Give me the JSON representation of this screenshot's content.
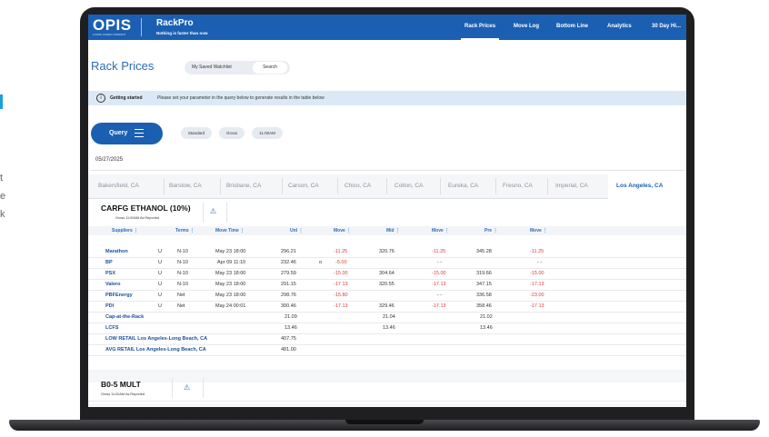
{
  "background_letters": [
    "t",
    "e",
    "k"
  ],
  "header": {
    "logo": "OPIS",
    "logo_subtitle": "A DOW JONES COMPANY",
    "app_name": "RackPro",
    "app_tagline": "Nothing is faster than now",
    "nav": [
      "Rack Prices",
      "Move Log",
      "Bottom Line",
      "Analytics",
      "30 Day Hi..."
    ],
    "active_nav": "Rack Prices"
  },
  "page": {
    "title": "Rack Prices",
    "toggle": {
      "left": "My Saved Watchlist",
      "right": "Search"
    },
    "banner": {
      "bold": "Getting started",
      "text": "Please set your parameter in the query below to generate results in the table below"
    },
    "query_button": "Query",
    "chips": [
      "Standard",
      "Gross",
      "11:00AM"
    ],
    "date": "05/27/2025"
  },
  "city_tabs": [
    "Bakersfield, CA",
    "Barstow, CA",
    "Brisbane, CA",
    "Carson, CA",
    "Chico, CA",
    "Colton, CA",
    "Eureka, CA",
    "Fresno, CA",
    "Imperial, CA",
    "Los Angeles, CA"
  ],
  "active_city": "Los Angeles, CA",
  "product1": {
    "title": "CARFG ETHANOL (10%)",
    "subtitle": "Gross 11:00AM As Reported"
  },
  "table": {
    "headers": {
      "suppliers": "Suppliers ⋮",
      "terms": "Terms ⋮",
      "move_time": "Move Time ⋮",
      "unl": "Unl ⋮",
      "move1": "Move ⋮",
      "mid": "Mid ⋮",
      "move2": "Move ⋮",
      "pre": "Pre ⋮",
      "move3": "Move ⋮"
    },
    "rows": [
      {
        "supplier": "Marathon",
        "u": "U",
        "terms": "N-10",
        "time": "May 23 18:00",
        "unl": "296.21",
        "flag": "",
        "move1": "-11.25",
        "mid": "320.76",
        "move2": "-11.25",
        "pre": "345.28",
        "move3": "-11.25"
      },
      {
        "supplier": "BP",
        "u": "U",
        "terms": "N-10",
        "time": "Apr 09 11:10",
        "unl": "232.46",
        "flag": "o",
        "move1": "-5.00",
        "mid": "",
        "move2": "- -",
        "pre": "",
        "move3": "- -"
      },
      {
        "supplier": "PSX",
        "u": "U",
        "terms": "N-10",
        "time": "May 23 18:00",
        "unl": "279.59",
        "flag": "",
        "move1": "-15.00",
        "mid": "304.64",
        "move2": "-15.00",
        "pre": "319.66",
        "move3": "-15.00"
      },
      {
        "supplier": "Valero",
        "u": "U",
        "terms": "N-10",
        "time": "May 23 18:00",
        "unl": "291.15",
        "flag": "",
        "move1": "-17.13",
        "mid": "320.55",
        "move2": "-17.13",
        "pre": "347.15",
        "move3": "-17.13"
      },
      {
        "supplier": "PBFEnergy",
        "u": "U",
        "terms": "Net",
        "time": "May 23 18:00",
        "unl": "298.76",
        "flag": "",
        "move1": "-15.80",
        "mid": "",
        "move2": "- -",
        "pre": "336.58",
        "move3": "-23.00"
      },
      {
        "supplier": "PDI",
        "u": "U",
        "terms": "Net",
        "time": "May 24 00:01",
        "unl": "300.46",
        "flag": "",
        "move1": "-17.13",
        "mid": "329.46",
        "move2": "-17.13",
        "pre": "358.46",
        "move3": "-17.13"
      }
    ],
    "summary": [
      {
        "label": "Cap-at-the-Rack",
        "unl": "21.09",
        "mid": "21.04",
        "pre": "21.02"
      },
      {
        "label": "LCFS",
        "unl": "13.46",
        "mid": "13.46",
        "pre": "13.46"
      },
      {
        "label": "LOW RETAIL Los Angeles-Long Beach, CA",
        "unl": "407.75",
        "mid": "",
        "pre": ""
      },
      {
        "label": "AVG RETAIL Los Angeles-Long Beach, CA",
        "unl": "481.00",
        "mid": "",
        "pre": ""
      }
    ]
  },
  "product2": {
    "title": "B0-5 MULT",
    "subtitle": "Gross 11:00AM As Reported"
  }
}
